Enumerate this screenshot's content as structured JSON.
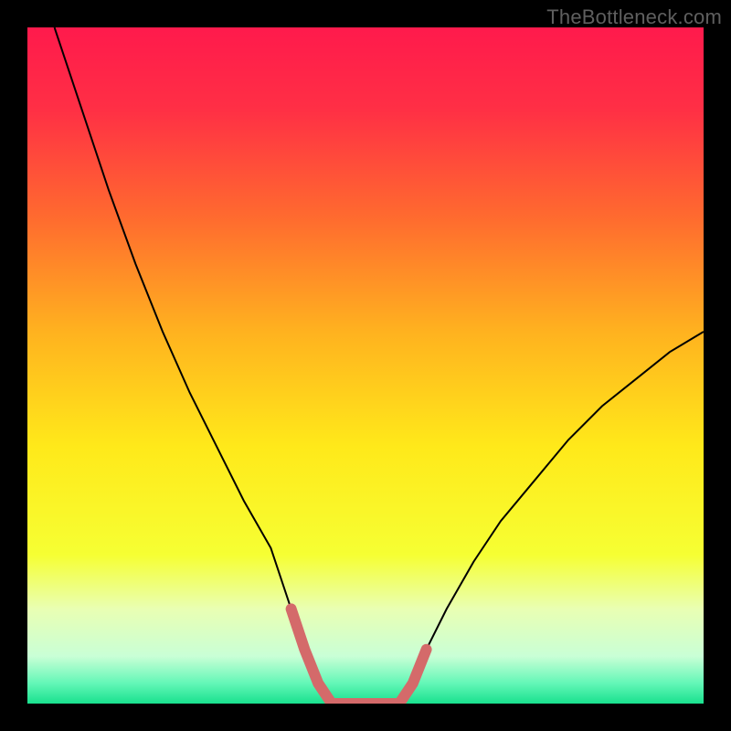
{
  "watermark": "TheBottleneck.com",
  "chart_data": {
    "type": "line",
    "title": "",
    "xlabel": "",
    "ylabel": "",
    "xlim": [
      0,
      100
    ],
    "ylim": [
      0,
      100
    ],
    "grid": false,
    "legend": false,
    "background": {
      "kind": "vertical_gradient",
      "stops": [
        {
          "pos": 0.0,
          "color": "#ff1a4c"
        },
        {
          "pos": 0.12,
          "color": "#ff2f45"
        },
        {
          "pos": 0.28,
          "color": "#ff6a2f"
        },
        {
          "pos": 0.45,
          "color": "#ffb21f"
        },
        {
          "pos": 0.62,
          "color": "#ffe91a"
        },
        {
          "pos": 0.78,
          "color": "#f6ff33"
        },
        {
          "pos": 0.86,
          "color": "#e9ffb3"
        },
        {
          "pos": 0.93,
          "color": "#c9ffd6"
        },
        {
          "pos": 0.97,
          "color": "#63f7b7"
        },
        {
          "pos": 1.0,
          "color": "#19e18e"
        }
      ]
    },
    "series": [
      {
        "name": "bottleneck_curve",
        "stroke": "#000000",
        "stroke_width": 2,
        "x": [
          4,
          8,
          12,
          16,
          20,
          24,
          28,
          32,
          36,
          39,
          41,
          43,
          45,
          50,
          55,
          57,
          59,
          62,
          66,
          70,
          75,
          80,
          85,
          90,
          95,
          100
        ],
        "y": [
          100,
          88,
          76,
          65,
          55,
          46,
          38,
          30,
          23,
          14,
          8,
          3,
          0,
          0,
          0,
          3,
          8,
          14,
          21,
          27,
          33,
          39,
          44,
          48,
          52,
          55
        ]
      },
      {
        "name": "floor_segment",
        "stroke": "#d46a6a",
        "stroke_width": 12,
        "linecap": "round",
        "x": [
          39,
          41,
          43,
          45,
          50,
          55,
          57,
          59
        ],
        "y": [
          14,
          8,
          3,
          0,
          0,
          0,
          3,
          8
        ]
      }
    ]
  }
}
